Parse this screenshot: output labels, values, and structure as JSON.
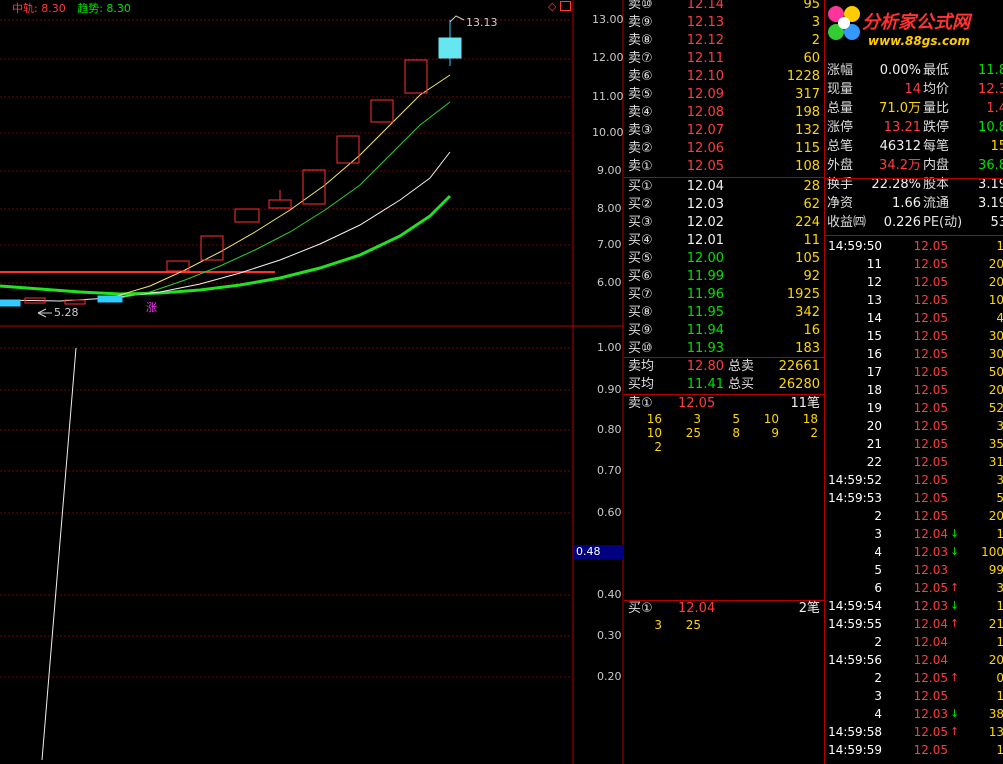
{
  "header": {
    "mid_label": "中轨: 8.30",
    "trend_label": "趋势: 8.30",
    "icons": [
      "diamond-icon",
      "window-icon"
    ]
  },
  "kline": {
    "price_ticks": [
      "13.00",
      "12.00",
      "11.00",
      "10.00",
      "9.00",
      "8.00",
      "7.00",
      "6.00"
    ],
    "high_label": "13.13",
    "low_label": "5.28",
    "marker": "涨"
  },
  "lower": {
    "ticks": [
      "1.00",
      "0.90",
      "0.80",
      "0.70",
      "0.60",
      "0.40",
      "0.30",
      "0.20"
    ],
    "current_value": "0.48"
  },
  "order_book": {
    "asks": [
      {
        "label": "卖⑩",
        "price": "12.14",
        "vol": "95"
      },
      {
        "label": "卖⑨",
        "price": "12.13",
        "vol": "3"
      },
      {
        "label": "卖⑧",
        "price": "12.12",
        "vol": "2"
      },
      {
        "label": "卖⑦",
        "price": "12.11",
        "vol": "60"
      },
      {
        "label": "卖⑥",
        "price": "12.10",
        "vol": "1228"
      },
      {
        "label": "卖⑤",
        "price": "12.09",
        "vol": "317"
      },
      {
        "label": "卖④",
        "price": "12.08",
        "vol": "198"
      },
      {
        "label": "卖③",
        "price": "12.07",
        "vol": "132"
      },
      {
        "label": "卖②",
        "price": "12.06",
        "vol": "115"
      },
      {
        "label": "卖①",
        "price": "12.05",
        "vol": "108"
      }
    ],
    "bids": [
      {
        "label": "买①",
        "price": "12.04",
        "vol": "28"
      },
      {
        "label": "买②",
        "price": "12.03",
        "vol": "62"
      },
      {
        "label": "买③",
        "price": "12.02",
        "vol": "224"
      },
      {
        "label": "买④",
        "price": "12.01",
        "vol": "11"
      },
      {
        "label": "买⑤",
        "price": "12.00",
        "vol": "105"
      },
      {
        "label": "买⑥",
        "price": "11.99",
        "vol": "92"
      },
      {
        "label": "买⑦",
        "price": "11.96",
        "vol": "1925"
      },
      {
        "label": "买⑧",
        "price": "11.95",
        "vol": "342"
      },
      {
        "label": "买⑨",
        "price": "11.94",
        "vol": "16"
      },
      {
        "label": "买⑩",
        "price": "11.93",
        "vol": "183"
      }
    ],
    "avg_sell_label": "卖均",
    "avg_sell": "12.80",
    "total_sell_label": "总卖",
    "total_sell": "22661",
    "avg_buy_label": "买均",
    "avg_buy": "11.41",
    "total_buy_label": "总买",
    "total_buy": "26280",
    "queue_sell": {
      "label": "卖①",
      "price": "12.05",
      "count": "11笔",
      "rows": [
        [
          "16",
          "3",
          "5",
          "10",
          "18"
        ],
        [
          "10",
          "25",
          "8",
          "9",
          "2"
        ],
        [
          "2"
        ]
      ]
    },
    "queue_buy": {
      "label": "买①",
      "price": "12.04",
      "count": "2笔",
      "rows": [
        [
          "3",
          "25"
        ]
      ]
    }
  },
  "logo": {
    "title": "分析家公式网",
    "url": "www.88gs.com"
  },
  "info": [
    {
      "a": "涨幅",
      "b": "0.00%",
      "c": "最低",
      "d": "11.8",
      "bc": "wht",
      "dc": "grn"
    },
    {
      "a": "现量",
      "b": "14",
      "c": "均价",
      "d": "12.3",
      "bc": "red",
      "dc": "red"
    },
    {
      "a": "总量",
      "b": "71.0万",
      "c": "量比",
      "d": "1.4",
      "bc": "yel",
      "dc": "red"
    },
    {
      "a": "涨停",
      "b": "13.21",
      "c": "跌停",
      "d": "10.8",
      "bc": "red",
      "dc": "grn"
    },
    {
      "a": "总笔",
      "b": "46312",
      "c": "每笔",
      "d": "15",
      "bc": "wht",
      "dc": "yel"
    },
    {
      "a": "外盘",
      "b": "34.2万",
      "c": "内盘",
      "d": "36.8",
      "bc": "red",
      "dc": "grn"
    },
    {
      "a": "换手",
      "b": "22.28%",
      "c": "股本",
      "d": "3.19",
      "bc": "wht",
      "dc": "wht"
    },
    {
      "a": "净资",
      "b": "1.66",
      "c": "流通",
      "d": "3.19",
      "bc": "wht",
      "dc": "wht"
    },
    {
      "a": "收益㈣",
      "b": "0.226",
      "c": "PE(动)",
      "d": "53",
      "bc": "wht",
      "dc": "wht"
    }
  ],
  "ticks": [
    {
      "t": "14:59:50",
      "p": "12.05",
      "a": "",
      "v": "1"
    },
    {
      "t": "11",
      "p": "12.05",
      "a": "",
      "v": "20"
    },
    {
      "t": "12",
      "p": "12.05",
      "a": "",
      "v": "20"
    },
    {
      "t": "13",
      "p": "12.05",
      "a": "",
      "v": "10"
    },
    {
      "t": "14",
      "p": "12.05",
      "a": "",
      "v": "4"
    },
    {
      "t": "15",
      "p": "12.05",
      "a": "",
      "v": "30"
    },
    {
      "t": "16",
      "p": "12.05",
      "a": "",
      "v": "30"
    },
    {
      "t": "17",
      "p": "12.05",
      "a": "",
      "v": "50"
    },
    {
      "t": "18",
      "p": "12.05",
      "a": "",
      "v": "20"
    },
    {
      "t": "19",
      "p": "12.05",
      "a": "",
      "v": "52"
    },
    {
      "t": "20",
      "p": "12.05",
      "a": "",
      "v": "3"
    },
    {
      "t": "21",
      "p": "12.05",
      "a": "",
      "v": "35"
    },
    {
      "t": "22",
      "p": "12.05",
      "a": "",
      "v": "31"
    },
    {
      "t": "14:59:52",
      "p": "12.05",
      "a": "",
      "v": "3"
    },
    {
      "t": "14:59:53",
      "p": "12.05",
      "a": "",
      "v": "5"
    },
    {
      "t": "2",
      "p": "12.05",
      "a": "",
      "v": "20"
    },
    {
      "t": "3",
      "p": "12.04",
      "a": "↓",
      "v": "1"
    },
    {
      "t": "4",
      "p": "12.03",
      "a": "↓",
      "v": "100"
    },
    {
      "t": "5",
      "p": "12.03",
      "a": "",
      "v": "99"
    },
    {
      "t": "6",
      "p": "12.05",
      "a": "↑",
      "v": "3"
    },
    {
      "t": "14:59:54",
      "p": "12.03",
      "a": "↓",
      "v": "1"
    },
    {
      "t": "14:59:55",
      "p": "12.04",
      "a": "↑",
      "v": "21"
    },
    {
      "t": "2",
      "p": "12.04",
      "a": "",
      "v": "1"
    },
    {
      "t": "14:59:56",
      "p": "12.04",
      "a": "",
      "v": "20"
    },
    {
      "t": "2",
      "p": "12.05",
      "a": "↑",
      "v": "0"
    },
    {
      "t": "3",
      "p": "12.05",
      "a": "",
      "v": "1"
    },
    {
      "t": "4",
      "p": "12.03",
      "a": "↓",
      "v": "38"
    },
    {
      "t": "14:59:58",
      "p": "12.05",
      "a": "↑",
      "v": "13"
    },
    {
      "t": "14:59:59",
      "p": "12.05",
      "a": "",
      "v": "1"
    }
  ]
}
